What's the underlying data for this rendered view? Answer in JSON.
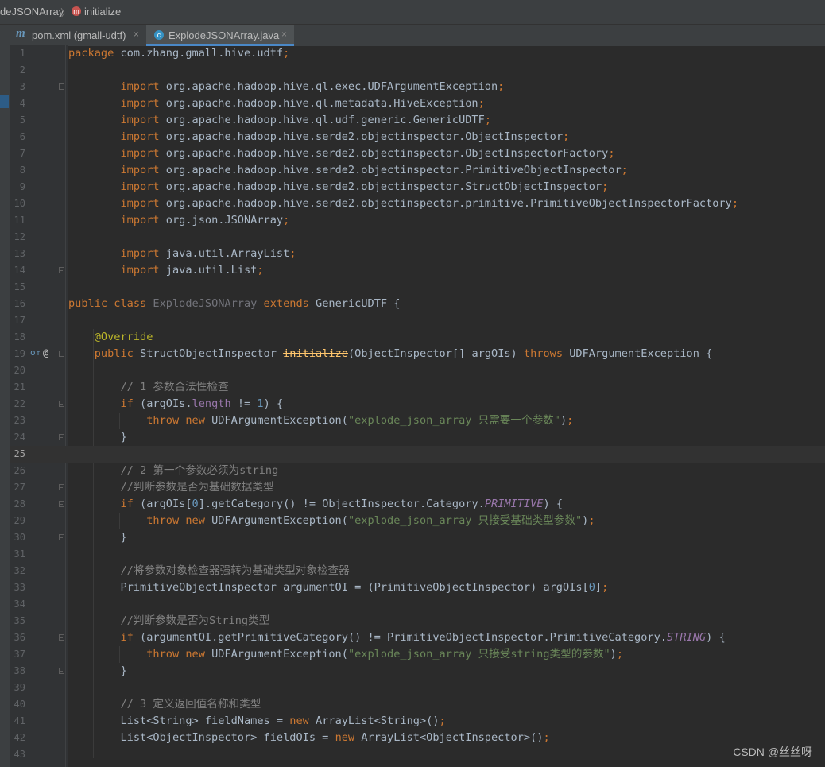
{
  "breadcrumb": {
    "file": "deJSONArray",
    "method_badge": "m",
    "method": "initialize"
  },
  "tabs": [
    {
      "badge": "m",
      "label": "pom.xml (gmall-udtf)",
      "close": "×"
    },
    {
      "badge": "c",
      "label": "ExplodeJSONArray.java",
      "close": "×"
    }
  ],
  "editor": {
    "line_numbers": [
      "1",
      "2",
      "3",
      "4",
      "5",
      "6",
      "7",
      "8",
      "9",
      "10",
      "11",
      "12",
      "13",
      "14",
      "15",
      "16",
      "17",
      "18",
      "19",
      "20",
      "21",
      "22",
      "23",
      "24",
      "25",
      "26",
      "27",
      "28",
      "29",
      "30",
      "31",
      "32",
      "33",
      "34",
      "35",
      "36",
      "37",
      "38",
      "39",
      "40",
      "41",
      "42",
      "43"
    ],
    "current_line": "25",
    "gutter_markers": {
      "override": "o↑",
      "annotation": "@"
    }
  },
  "watermark": "CSDN @丝丝呀"
}
